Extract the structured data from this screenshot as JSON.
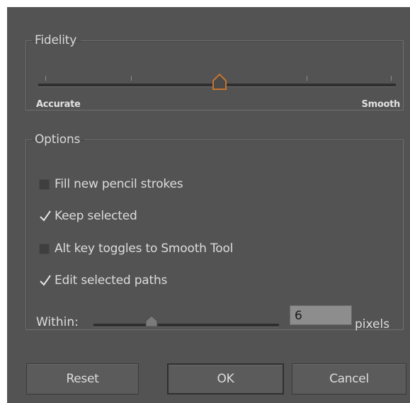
{
  "fidelity": {
    "legend": "Fidelity",
    "min_label": "Accurate",
    "max_label": "Smooth",
    "value_fraction": 0.5,
    "tick_count": 5
  },
  "options": {
    "legend": "Options",
    "fill_new_pencil_strokes": {
      "label": "Fill new pencil strokes",
      "checked": false
    },
    "keep_selected": {
      "label": "Keep selected",
      "checked": true
    },
    "alt_key_toggles": {
      "label": "Alt key toggles to Smooth Tool",
      "checked": false
    },
    "edit_selected_paths": {
      "label": "Edit selected paths",
      "checked": true
    },
    "within": {
      "label": "Within:",
      "value": "6",
      "unit": "pixels",
      "slider_fraction": 0.3
    }
  },
  "buttons": {
    "reset": "Reset",
    "ok": "OK",
    "cancel": "Cancel"
  },
  "colors": {
    "dialog_bg": "#535353",
    "accent_thumb": "#c8742e",
    "text": "#dcdcdc"
  }
}
